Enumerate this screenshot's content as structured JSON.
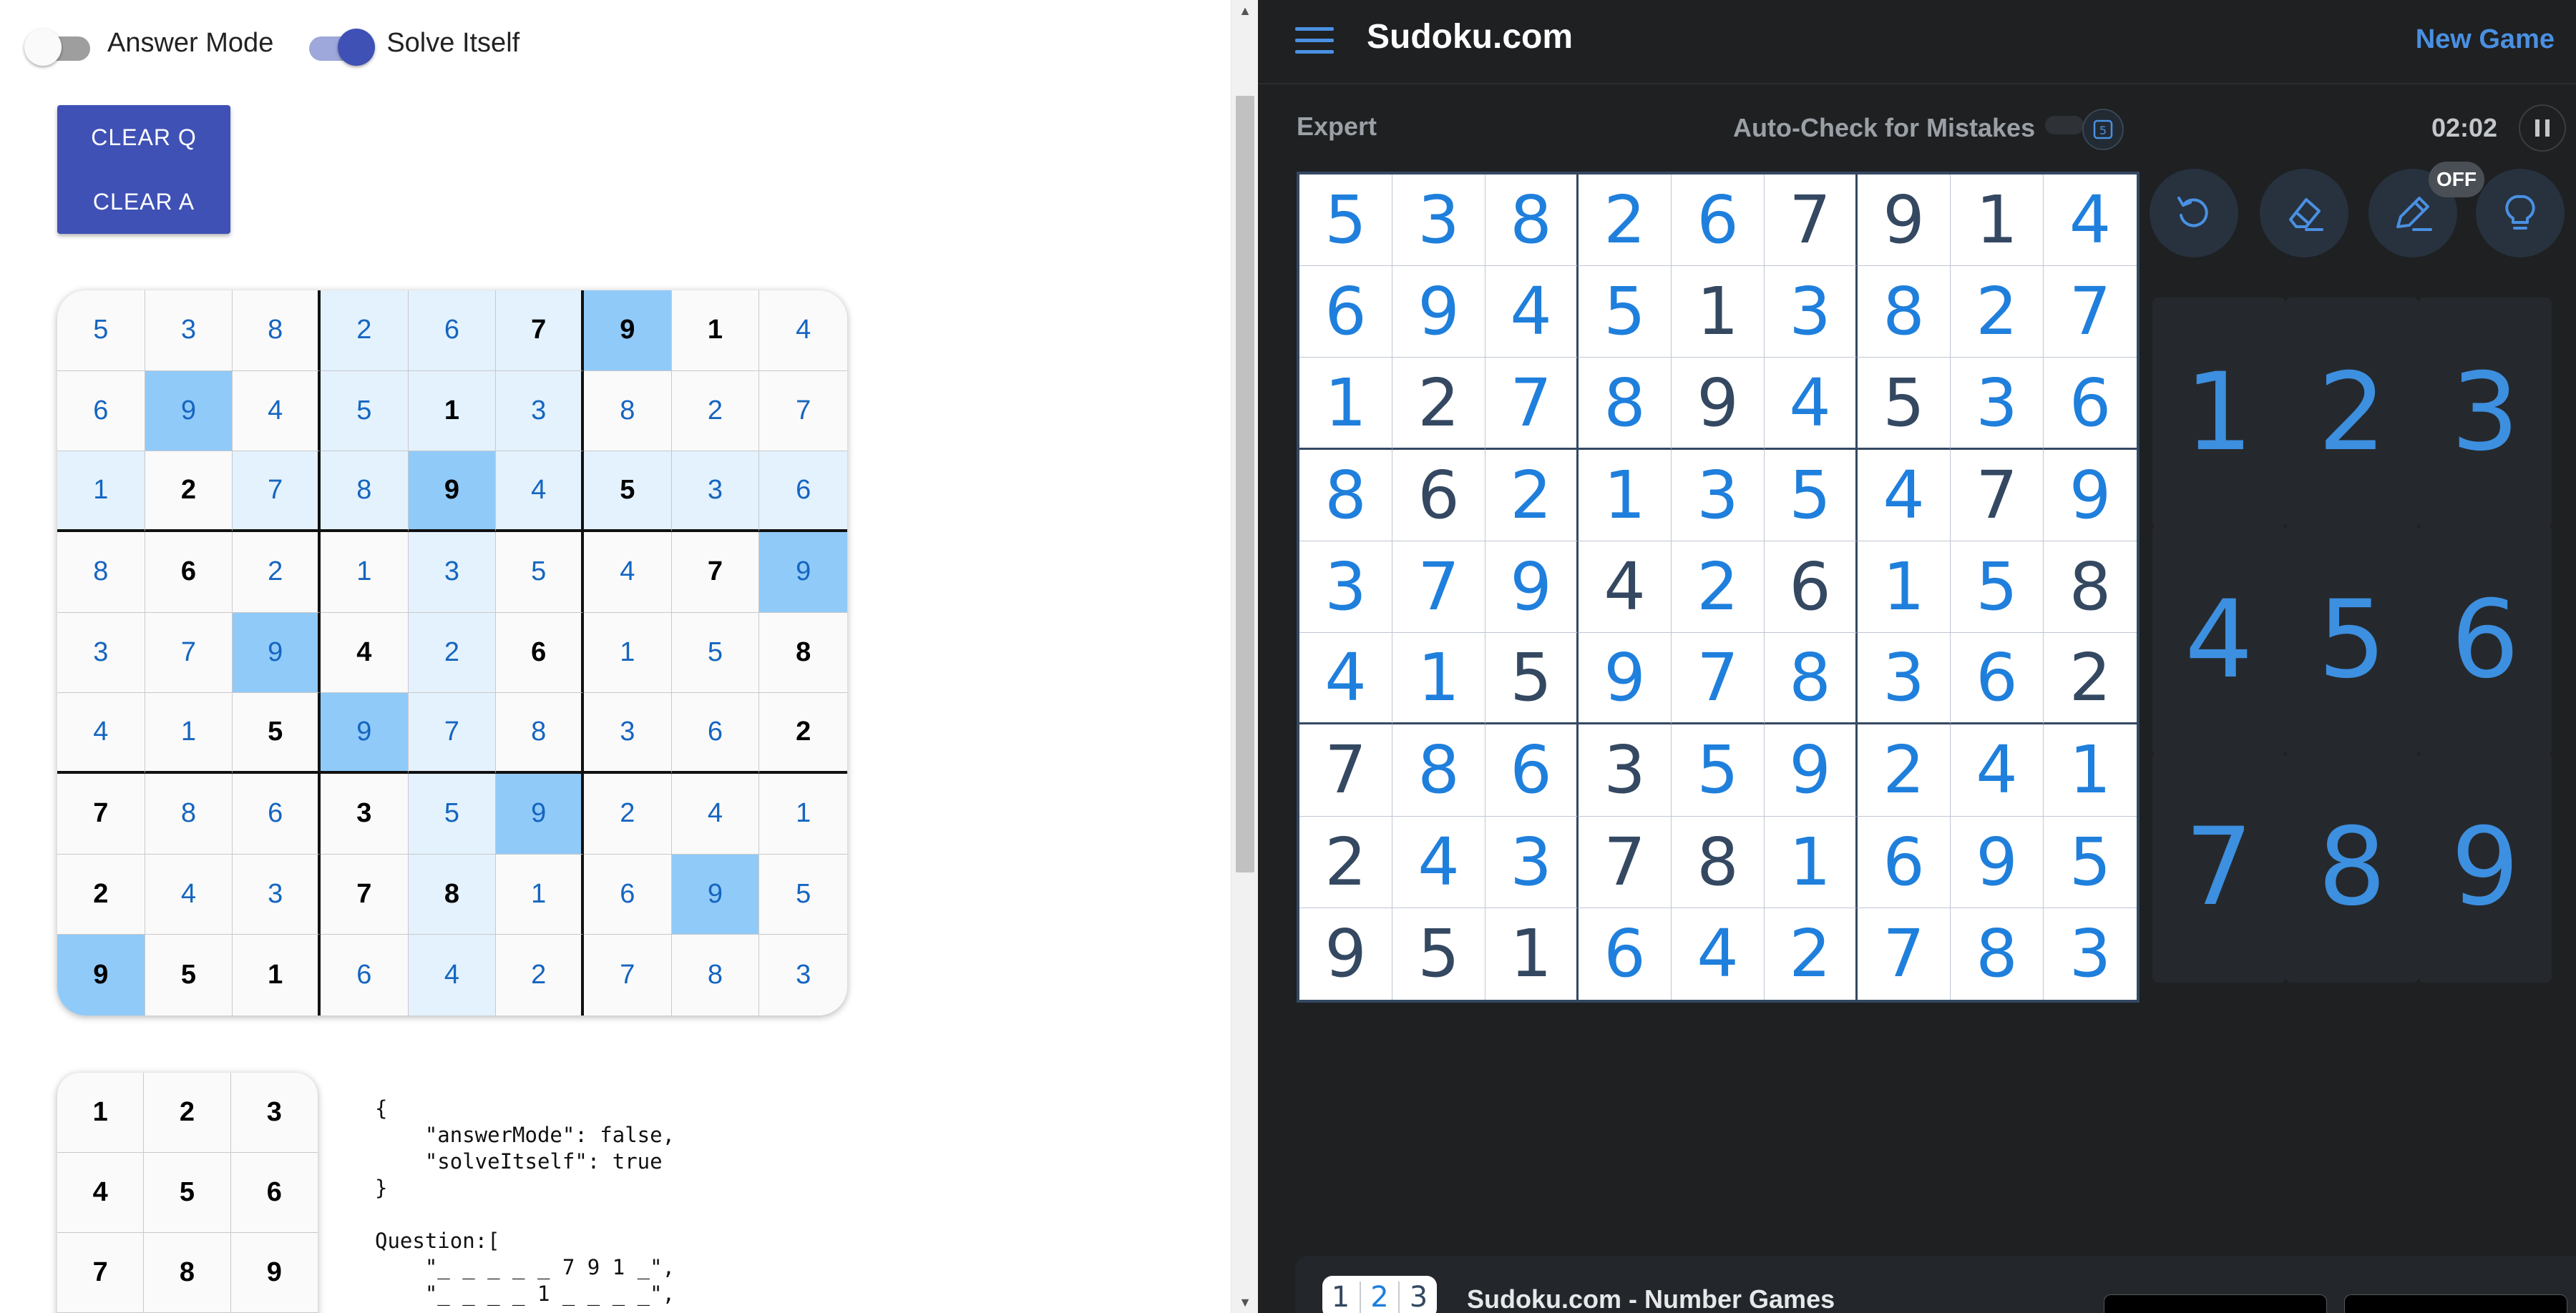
{
  "left": {
    "toggles": {
      "answer_mode_label": "Answer Mode",
      "answer_mode_on": false,
      "solve_itself_label": "Solve Itself",
      "solve_itself_on": true
    },
    "buttons": {
      "clear_q": "CLEAR Q",
      "clear_a": "CLEAR A"
    },
    "grid": [
      [
        5,
        3,
        8,
        2,
        6,
        7,
        9,
        1,
        4
      ],
      [
        6,
        9,
        4,
        5,
        1,
        3,
        8,
        2,
        7
      ],
      [
        1,
        2,
        7,
        8,
        9,
        4,
        5,
        3,
        6
      ],
      [
        8,
        6,
        2,
        1,
        3,
        5,
        4,
        7,
        9
      ],
      [
        3,
        7,
        9,
        4,
        2,
        6,
        1,
        5,
        8
      ],
      [
        4,
        1,
        5,
        9,
        7,
        8,
        3,
        6,
        2
      ],
      [
        7,
        8,
        6,
        3,
        5,
        9,
        2,
        4,
        1
      ],
      [
        2,
        4,
        3,
        7,
        8,
        1,
        6,
        9,
        5
      ],
      [
        9,
        5,
        1,
        6,
        4,
        2,
        7,
        8,
        3
      ]
    ],
    "givens": [
      [
        0,
        5
      ],
      [
        0,
        6
      ],
      [
        0,
        7
      ],
      [
        1,
        4
      ],
      [
        2,
        1
      ],
      [
        2,
        4
      ],
      [
        2,
        6
      ],
      [
        3,
        1
      ],
      [
        3,
        7
      ],
      [
        4,
        3
      ],
      [
        4,
        5
      ],
      [
        4,
        8
      ],
      [
        5,
        2
      ],
      [
        5,
        8
      ],
      [
        6,
        0
      ],
      [
        6,
        3
      ],
      [
        7,
        0
      ],
      [
        7,
        3
      ],
      [
        7,
        4
      ],
      [
        8,
        0
      ],
      [
        8,
        1
      ],
      [
        8,
        2
      ]
    ],
    "selected_cells": [
      [
        0,
        6
      ],
      [
        1,
        1
      ],
      [
        2,
        4
      ],
      [
        3,
        8
      ],
      [
        4,
        2
      ],
      [
        5,
        3
      ],
      [
        6,
        5
      ],
      [
        7,
        7
      ],
      [
        8,
        0
      ]
    ],
    "highlight_cells": [
      [
        0,
        3
      ],
      [
        0,
        4
      ],
      [
        0,
        5
      ],
      [
        1,
        3
      ],
      [
        1,
        4
      ],
      [
        1,
        5
      ],
      [
        2,
        3
      ],
      [
        2,
        5
      ],
      [
        2,
        0
      ],
      [
        2,
        2
      ],
      [
        2,
        6
      ],
      [
        2,
        7
      ],
      [
        2,
        8
      ],
      [
        3,
        4
      ],
      [
        4,
        4
      ],
      [
        5,
        4
      ],
      [
        6,
        4
      ],
      [
        7,
        4
      ],
      [
        8,
        4
      ]
    ],
    "keypad": [
      "1",
      "2",
      "3",
      "4",
      "5",
      "6",
      "7",
      "8",
      "9"
    ],
    "json_text": "{\n    \"answerMode\": false,\n    \"solveItself\": true\n}\n\nQuestion:[\n    \"_ _ _ _ _ 7 9 1 _\",\n    \"_ _ _ _ 1 _ _ _ _\","
  },
  "right": {
    "brand": "Sudoku.com",
    "new_game": "New Game",
    "difficulty": "Expert",
    "autocheck_label": "Auto-Check for Mistakes",
    "timer": "02:02",
    "notes_badge": "OFF",
    "grid": [
      [
        5,
        3,
        8,
        2,
        6,
        7,
        9,
        1,
        4
      ],
      [
        6,
        9,
        4,
        5,
        1,
        3,
        8,
        2,
        7
      ],
      [
        1,
        2,
        7,
        8,
        9,
        4,
        5,
        3,
        6
      ],
      [
        8,
        6,
        2,
        1,
        3,
        5,
        4,
        7,
        9
      ],
      [
        3,
        7,
        9,
        4,
        2,
        6,
        1,
        5,
        8
      ],
      [
        4,
        1,
        5,
        9,
        7,
        8,
        3,
        6,
        2
      ],
      [
        7,
        8,
        6,
        3,
        5,
        9,
        2,
        4,
        1
      ],
      [
        2,
        4,
        3,
        7,
        8,
        1,
        6,
        9,
        5
      ],
      [
        9,
        5,
        1,
        6,
        4,
        2,
        7,
        8,
        3
      ]
    ],
    "givens": [
      [
        0,
        5
      ],
      [
        0,
        6
      ],
      [
        0,
        7
      ],
      [
        1,
        4
      ],
      [
        2,
        1
      ],
      [
        2,
        4
      ],
      [
        2,
        6
      ],
      [
        3,
        1
      ],
      [
        3,
        7
      ],
      [
        4,
        3
      ],
      [
        4,
        5
      ],
      [
        4,
        8
      ],
      [
        5,
        2
      ],
      [
        5,
        8
      ],
      [
        6,
        0
      ],
      [
        6,
        3
      ],
      [
        7,
        0
      ],
      [
        7,
        3
      ],
      [
        7,
        4
      ],
      [
        8,
        0
      ],
      [
        8,
        1
      ],
      [
        8,
        2
      ]
    ],
    "numpad": [
      "1",
      "2",
      "3",
      "4",
      "5",
      "6",
      "7",
      "8",
      "9"
    ],
    "footer": {
      "logo_digits": [
        "1",
        "2",
        "3"
      ],
      "title": "Sudoku.com - Number Games"
    },
    "colors": {
      "accent": "#1f7fdc",
      "given": "#344861",
      "bg": "#1e2022"
    }
  }
}
